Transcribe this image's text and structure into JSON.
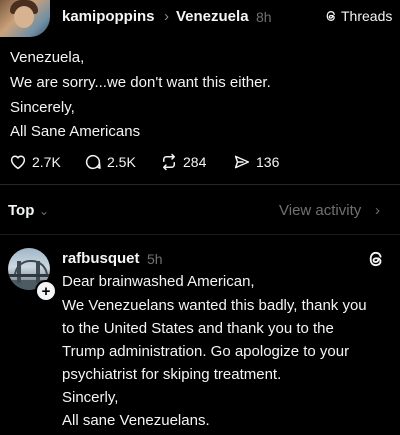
{
  "post": {
    "author": "kamipoppins",
    "chevron": "›",
    "topic": "Venezuela",
    "time": "8h",
    "source_label": "Threads",
    "lines": [
      "Venezuela,",
      "We are sorry...we don't want this either.",
      "Sincerely,",
      "All Sane Americans"
    ],
    "actions": {
      "likes": "2.7K",
      "replies": "2.5K",
      "reposts": "284",
      "shares": "136"
    }
  },
  "sort": {
    "label": "Top",
    "chevron": "⌄",
    "view_activity": "View activity",
    "view_activity_chevron": "›"
  },
  "reply": {
    "author": "rafbusquet",
    "time": "5h",
    "follow_symbol": "+",
    "lines": [
      "Dear brainwashed American,",
      "We Venezuelans wanted this badly, thank you",
      "to the United States and thank you to the",
      "Trump administration. Go apologize to your",
      "psychiatrist for skiping treatment.",
      "Sincerly,",
      "All sane Venezuelans."
    ]
  },
  "icons": {
    "like": "heart-icon",
    "reply": "comment-icon",
    "repost": "repost-icon",
    "share": "share-icon",
    "threads": "threads-logo-icon"
  },
  "colors": {
    "background": "#000000",
    "text": "#f3f5f7",
    "muted": "#6e7174"
  }
}
